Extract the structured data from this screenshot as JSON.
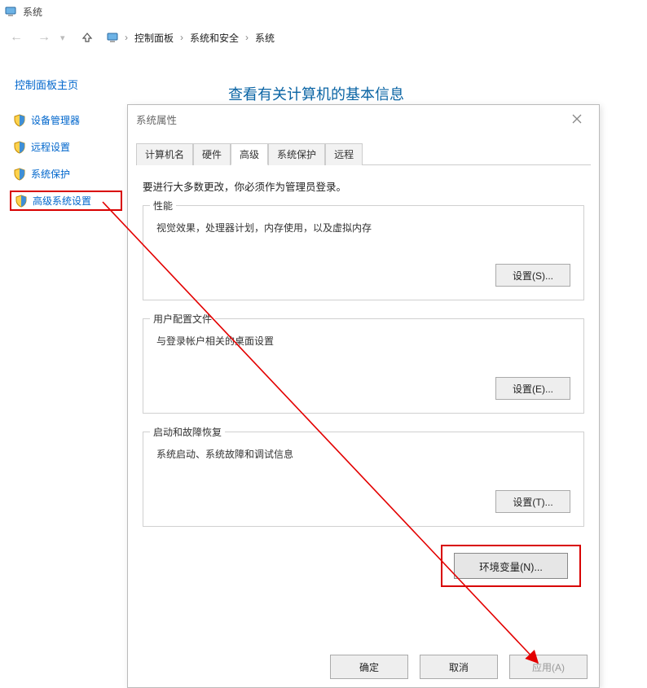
{
  "window_title": "系统",
  "nav": {
    "crumbs": [
      "控制面板",
      "系统和安全",
      "系统"
    ]
  },
  "sidebar": {
    "home": "控制面板主页",
    "items": [
      {
        "label": "设备管理器"
      },
      {
        "label": "远程设置"
      },
      {
        "label": "系统保护"
      },
      {
        "label": "高级系统设置"
      }
    ]
  },
  "main_heading": "查看有关计算机的基本信息",
  "dialog": {
    "title": "系统属性",
    "tabs": [
      "计算机名",
      "硬件",
      "高级",
      "系统保护",
      "远程"
    ],
    "active_tab_index": 2,
    "admin_note": "要进行大多数更改，你必须作为管理员登录。",
    "groups": [
      {
        "legend": "性能",
        "desc": "视觉效果，处理器计划，内存使用，以及虚拟内存",
        "btn": "设置(S)..."
      },
      {
        "legend": "用户配置文件",
        "desc": "与登录帐户相关的桌面设置",
        "btn": "设置(E)..."
      },
      {
        "legend": "启动和故障恢复",
        "desc": "系统启动、系统故障和调试信息",
        "btn": "设置(T)..."
      }
    ],
    "env_btn": "环境变量(N)...",
    "footer": {
      "ok": "确定",
      "cancel": "取消",
      "apply": "应用(A)"
    }
  }
}
